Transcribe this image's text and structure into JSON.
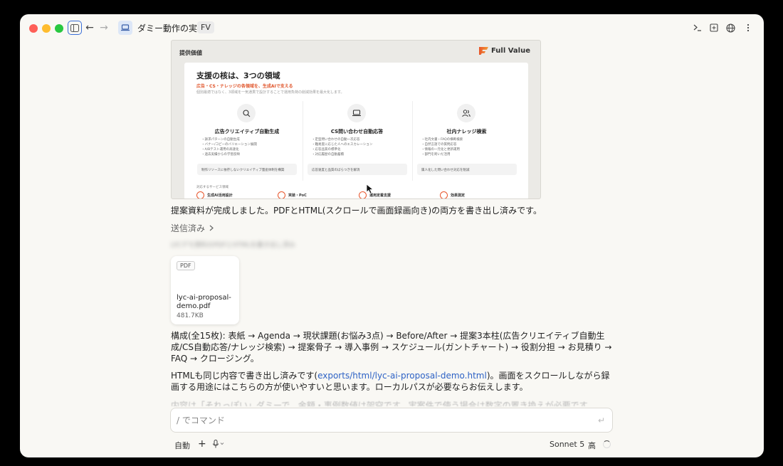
{
  "titlebar": {
    "project_title": "ダミー動作の実装",
    "project_badge": "FV"
  },
  "preview": {
    "header_label": "提供価値",
    "logo_text": "Full Value",
    "heading": "支援の核は、3つの領域",
    "subheading": "広告・CS・ナレッジの各領域を、生成AIで支える",
    "description": "個別最適ではなく、3領域を一気通貫で設計することで運用負荷の削減効果を最大化します。",
    "columns": [
      {
        "title": "広告クリエイティブ自動生成",
        "items": [
          "・訴求パターンの自動生成",
          "・バナー/コピーのバリエーション展開",
          "・A/Bテスト運用の高速化",
          "・過去実績からの学習反映"
        ],
        "note": "制作リソースに依存しないクリエイティブ量産体制を構築"
      },
      {
        "title": "CS問い合わせ自動応答",
        "items": [
          "・定型問い合わせの自動一次応答",
          "・難易度に応じた人へのエスカレーション",
          "・応答品質の標準化",
          "・対応履歴の自動蓄積"
        ],
        "note": "応答速度と品質のばらつきを解消"
      },
      {
        "title": "社内ナレッジ検索",
        "items": [
          "・社内文書・FAQの横断検索",
          "・自然言語での質問応答",
          "・情報の一元化と更新運用",
          "・部門を跨いだ活用"
        ],
        "note": "属人化した問い合わせ対応を削減"
      }
    ],
    "services_label": "対応するサービス領域",
    "services": [
      "生成AI活用設計",
      "実装・PoC",
      "運用定着支援",
      "効果測定"
    ]
  },
  "messages": {
    "done": "提案資料が完成しました。PDFとHTML(スクロールで画面録画向き)の両方を書き出し済みです。",
    "sent_label": "送信済み",
    "blurred_text": "LYCデモ資料のPDFとHTMLを書き出し済み",
    "file": {
      "tag": "PDF",
      "name": "lyc-ai-proposal-demo.pdf",
      "size": "481.7KB"
    },
    "composition": "構成(全15枚): 表紙 → Agenda → 現状課題(お悩み3点) → Before/After → 提案3本柱(広告クリエイティブ自動生成/CS自動応答/ナレッジ検索) → 提案骨子 → 導入事例 → スケジュール(ガントチャート) → 役割分担 → お見積り → FAQ → クロージング。",
    "html_note_prefix": "HTMLも同じ内容で書き出し済みです(",
    "html_note_link": "exports/html/lyc-ai-proposal-demo.html",
    "html_note_suffix": ")。画面をスクロールしながら録画する用途にはこちらの方が使いやすいと思います。ローカルパスが必要ならお伝えします。",
    "faded": "内容は「それっぽい」ダミーで、金額・事例数値は架空です。実案件で使う場合は数字の置き換えが必要です。"
  },
  "composer": {
    "placeholder": "/ でコマンド"
  },
  "footer": {
    "mode": "自動",
    "model": "Sonnet 5",
    "effort": "高"
  }
}
